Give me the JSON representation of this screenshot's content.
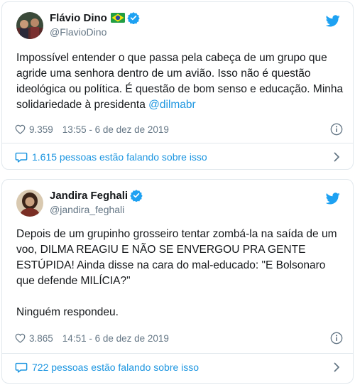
{
  "tweets": [
    {
      "display_name": "Flávio Dino",
      "handle": "@FlavioDino",
      "text": "Impossível entender o que passa pela cabeça de um grupo que agride uma senhora dentro de um avião. Isso não é questão ideológica ou política. É questão de bom senso e educação. Minha solidariedade à presidenta ",
      "mention": "@dilmabr",
      "likes": "9.359",
      "timestamp": "13:55 - 6 de dez de 2019",
      "conversation": "1.615 pessoas estão falando sobre isso"
    },
    {
      "display_name": "Jandira Feghali",
      "handle": "@jandira_feghali",
      "text": "Depois de um grupinho grosseiro tentar zombá-la na saída de um voo, DILMA REAGIU E NÃO SE ENVERGOU PRA GENTE ESTÚPIDA! Ainda disse na cara do mal-educado: \"E Bolsonaro que defende MILÍCIA?\"\n\nNinguém respondeu.",
      "likes": "3.865",
      "timestamp": "14:51 - 6 de dez de 2019",
      "conversation": "722 pessoas estão falando sobre isso"
    }
  ],
  "colors": {
    "twitter_blue": "#1da1f2",
    "link_blue": "#1b95e0",
    "secondary_text": "#657786",
    "border": "#e1e8ed"
  },
  "icons": [
    "avatar",
    "brazil-flag-icon",
    "verified-badge-icon",
    "twitter-bird-icon",
    "heart-icon",
    "info-icon",
    "speech-bubble-icon",
    "chevron-right-icon"
  ]
}
